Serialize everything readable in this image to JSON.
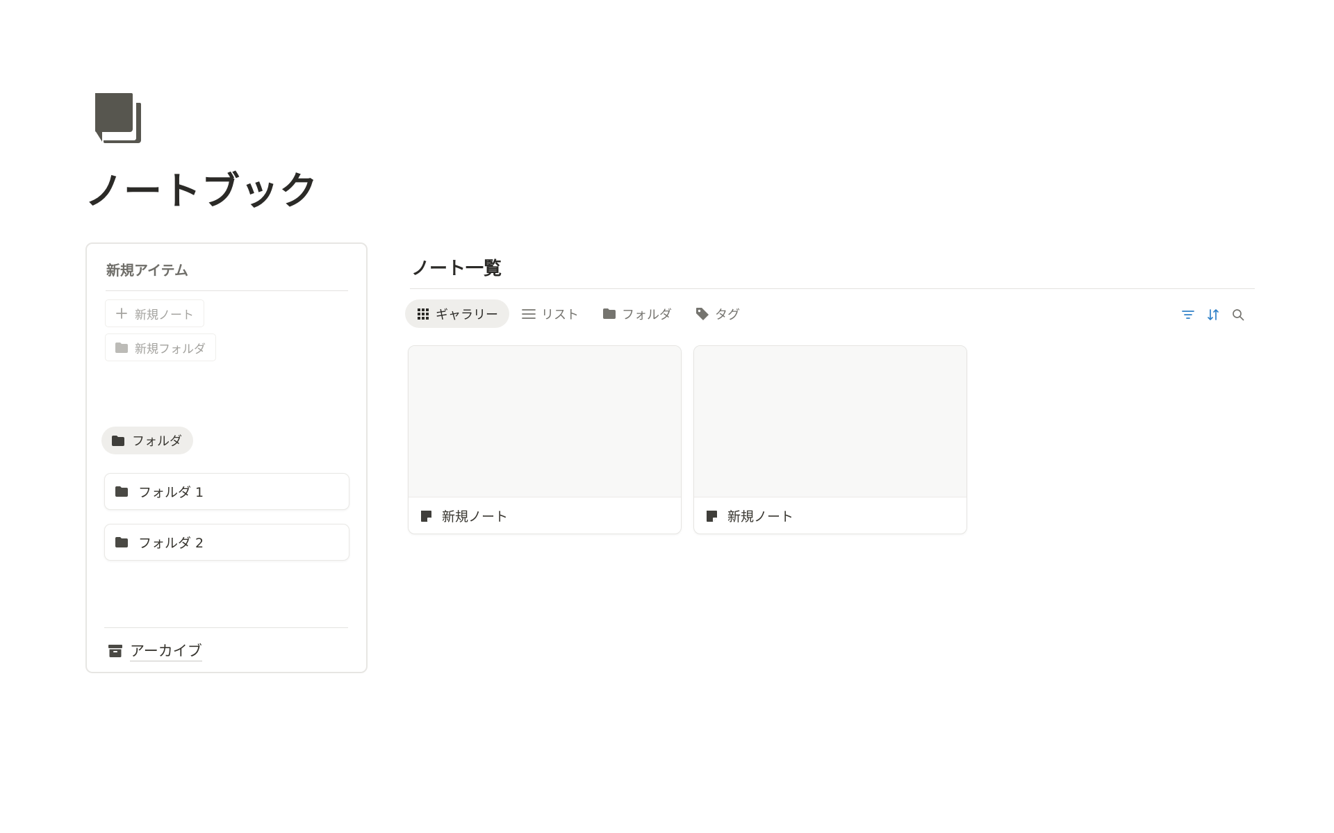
{
  "page": {
    "icon": "notebook-icon",
    "title": "ノートブック"
  },
  "sidebar": {
    "heading": "新規アイテム",
    "new_note": {
      "label": "新規ノート",
      "icon": "plus-icon"
    },
    "new_folder": {
      "label": "新規フォルダ",
      "icon": "folder-icon"
    },
    "folder_chip": {
      "label": "フォルダ",
      "icon": "folder-icon"
    },
    "folders": [
      {
        "label": "フォルダ 1",
        "icon": "folder-icon"
      },
      {
        "label": "フォルダ 2",
        "icon": "folder-icon"
      }
    ],
    "archive": {
      "label": "アーカイブ",
      "icon": "archive-icon"
    }
  },
  "main": {
    "title": "ノート一覧",
    "tabs": [
      {
        "label": "ギャラリー",
        "icon": "grid-icon",
        "active": true
      },
      {
        "label": "リスト",
        "icon": "list-icon",
        "active": false
      },
      {
        "label": "フォルダ",
        "icon": "folder-icon",
        "active": false
      },
      {
        "label": "タグ",
        "icon": "tag-icon",
        "active": false
      }
    ],
    "tools": [
      {
        "icon": "filter-icon",
        "color": "#2f80c8"
      },
      {
        "icon": "sort-icon",
        "color": "#2f80c8"
      },
      {
        "icon": "search-icon",
        "color": "#75746f"
      }
    ],
    "notes": [
      {
        "title": "新規ノート",
        "icon": "note-icon"
      },
      {
        "title": "新規ノート",
        "icon": "note-icon"
      }
    ]
  },
  "colors": {
    "text": "#37352f",
    "muted": "#a4a39f",
    "accent": "#2f80c8",
    "chip_bg": "#efeeeb",
    "card_preview": "#f8f8f7"
  }
}
